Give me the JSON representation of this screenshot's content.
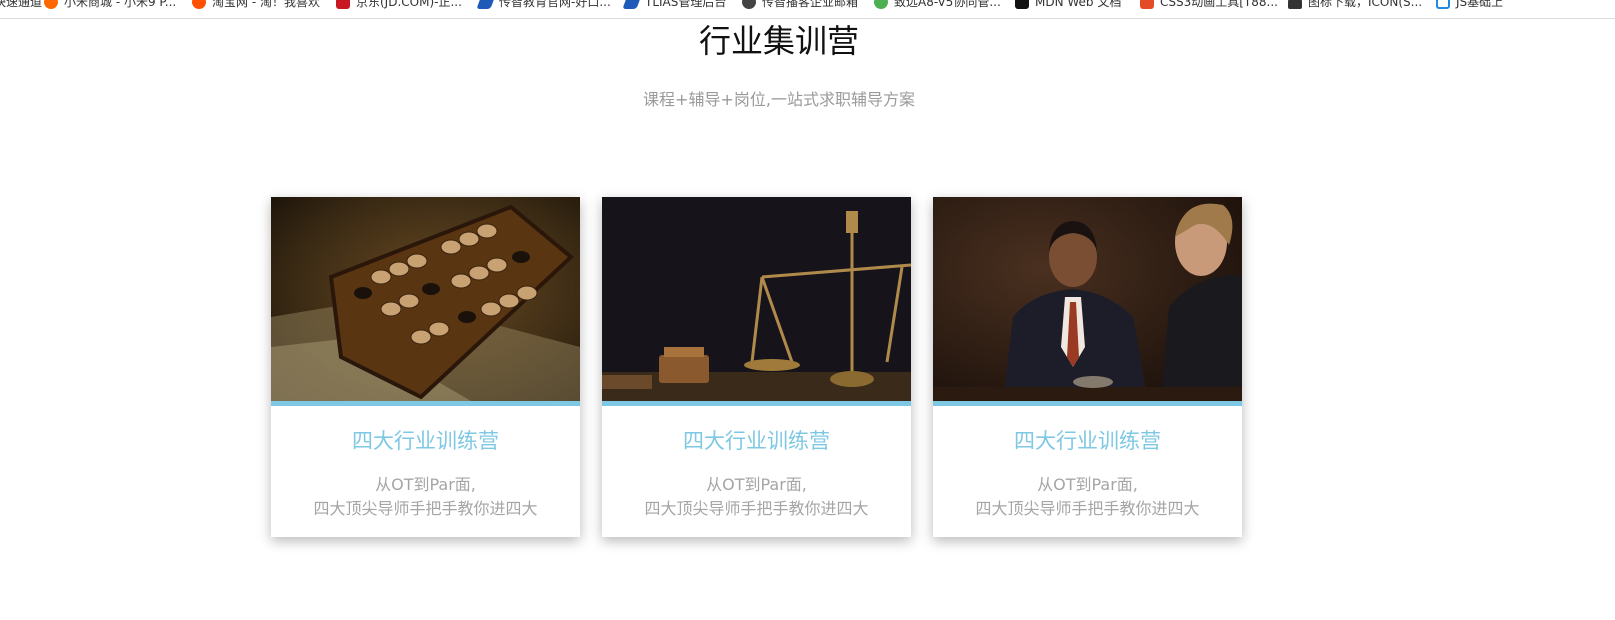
{
  "bookmarks": [
    {
      "label": "快速通道",
      "icon": "bookmark-icon",
      "color": "#8a8a8a"
    },
    {
      "label": "小米商城 - 小米9 P...",
      "icon": "mi-icon",
      "color": "#ff6700"
    },
    {
      "label": "淘宝网 - 淘！我喜欢",
      "icon": "taobao-icon",
      "color": "#ff5000"
    },
    {
      "label": "京东(JD.COM)-正...",
      "icon": "jd-icon",
      "color": "#c91623"
    },
    {
      "label": "传智教育官网-好口...",
      "icon": "itcast-icon",
      "color": "#1e5bb8"
    },
    {
      "label": "TLIAS管理后台",
      "icon": "tlias-icon",
      "color": "#1e5bb8"
    },
    {
      "label": "传智播客企业邮箱",
      "icon": "mail-icon",
      "color": "#444444"
    },
    {
      "label": "致远A8-V5协同管...",
      "icon": "seeyon-icon",
      "color": "#4caf50"
    },
    {
      "label": "MDN Web 文档",
      "icon": "mdn-icon",
      "color": "#111111"
    },
    {
      "label": "CSS3动画工具[T88...",
      "icon": "css3-icon",
      "color": "#e34c26"
    },
    {
      "label": "图标下载，ICON(S...",
      "icon": "iconfont-icon",
      "color": "#333333"
    },
    {
      "label": "JS基础上",
      "icon": "js-icon",
      "color": "#1e88e5"
    }
  ],
  "section": {
    "title": "行业集训营",
    "subtitle": "课程+辅导+岗位,一站式求职辅导方案"
  },
  "cards": [
    {
      "title": "四大行业训练营",
      "desc_line1": "从OT到Par面,",
      "desc_line2": "四大顶尖导师手把手教你进四大",
      "image": "abacus-image"
    },
    {
      "title": "四大行业训练营",
      "desc_line1": "从OT到Par面,",
      "desc_line2": "四大顶尖导师手把手教你进四大",
      "image": "scale-image"
    },
    {
      "title": "四大行业训练营",
      "desc_line1": "从OT到Par面,",
      "desc_line2": "四大顶尖导师手把手教你进四大",
      "image": "meeting-image"
    }
  ],
  "colors": {
    "accent": "#7ec8e3",
    "title": "#111111",
    "subtitle": "#9a9a9a",
    "desc": "#a5a5a5"
  }
}
